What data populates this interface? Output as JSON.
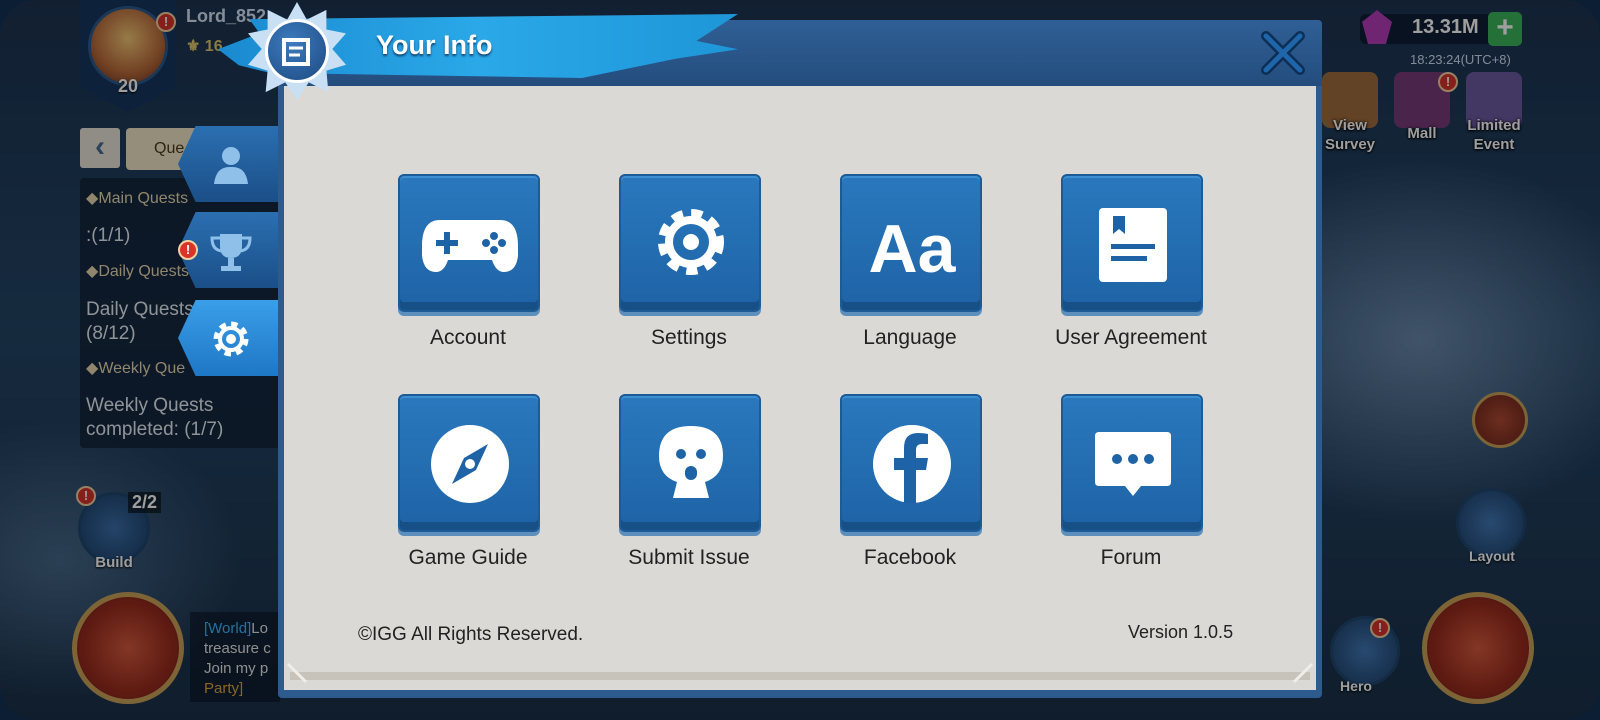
{
  "player": {
    "name": "Lord_852",
    "level": "20",
    "power": "16"
  },
  "resources": {
    "gems": "13.31M",
    "server_time": "18:23:24(UTC+8)"
  },
  "top_icons": [
    {
      "label": "View Survey"
    },
    {
      "label": "Mall"
    },
    {
      "label": "Limited Event"
    }
  ],
  "quest_panel": {
    "tab_label": "Que",
    "main_quests": "Main Quests",
    "main_progress": ":(1/1)",
    "daily_quests_header": "Daily Quests",
    "daily_quests_line1": "Daily Quests",
    "daily_quests_line2": "(8/12)",
    "weekly_header": "Weekly Que",
    "weekly_line1": "Weekly Quests",
    "weekly_line2": "completed: (1/7)"
  },
  "left_buttons": {
    "build_label": "Build",
    "build_count": "2/2"
  },
  "chat": {
    "world_tag": "[World]",
    "line1_rest": "Lo",
    "line2": "treasure c",
    "line3": "Join my p",
    "line4": "Party]"
  },
  "right_buttons": {
    "layout_label": "Layout",
    "hero_label": "Hero"
  },
  "dialog": {
    "title": "Your Info",
    "tiles": [
      {
        "label": "Account",
        "icon": "gamepad-icon"
      },
      {
        "label": "Settings",
        "icon": "gear-icon"
      },
      {
        "label": "Language",
        "icon": "language-icon"
      },
      {
        "label": "User Agreement",
        "icon": "document-icon"
      },
      {
        "label": "Game Guide",
        "icon": "compass-icon"
      },
      {
        "label": "Submit Issue",
        "icon": "feedback-icon"
      },
      {
        "label": "Facebook",
        "icon": "facebook-icon"
      },
      {
        "label": "Forum",
        "icon": "chat-icon"
      }
    ],
    "copyright": "©IGG All Rights Reserved.",
    "version": "Version 1.0.5"
  },
  "colors": {
    "dialog_frame": "#2e5b8e",
    "dialog_body": "#dbd9d5",
    "tile_blue": "#1e63a6",
    "banner_blue": "#2aa8e8"
  }
}
